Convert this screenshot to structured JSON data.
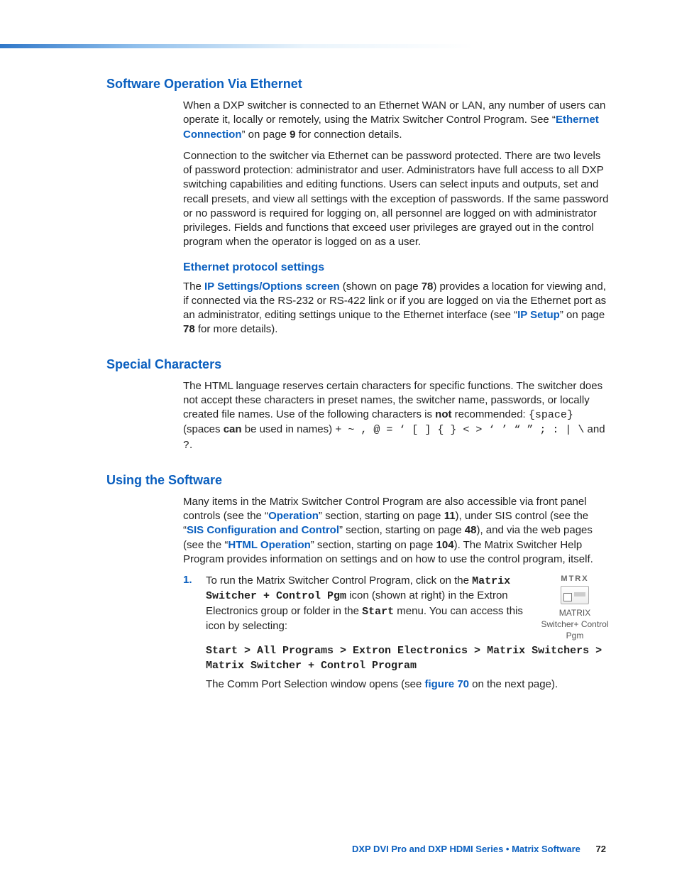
{
  "sections": {
    "swoe": {
      "title": "Software Operation Via Ethernet",
      "p1_a": "When a DXP switcher is connected to an Ethernet WAN or LAN, any number of users can operate it, locally or remotely, using the Matrix Switcher Control Program. See “",
      "p1_link": "Ethernet Connection",
      "p1_b": "” on page ",
      "p1_page": "9",
      "p1_c": " for connection details.",
      "p2": "Connection to the switcher via Ethernet can be password protected. There are two levels of password protection: administrator and user. Administrators have full access to all DXP switching capabilities and editing functions. Users can select inputs and outputs, set and recall presets, and view all settings with the exception of passwords. If the same password or no password is required for logging on, all personnel are logged on with administrator privileges. Fields and functions that exceed user privileges are grayed out in the control program when the operator is logged on as a user.",
      "sub_title": "Ethernet protocol settings",
      "p3_a": "The ",
      "p3_link1": "IP Settings/Options screen",
      "p3_b": " (shown on page ",
      "p3_page1": "78",
      "p3_c": ") provides a location for viewing and, if connected via the RS-232 or RS-422 link or if you are logged on via the Ethernet port as an administrator, editing settings unique to the Ethernet interface (see “",
      "p3_link2": "IP Setup",
      "p3_d": "” on page ",
      "p3_page2": "78",
      "p3_e": " for more details)."
    },
    "spec": {
      "title": "Special Characters",
      "p1_a": "The HTML language reserves certain characters for specific functions. The switcher does not accept these characters in preset names, the switcher name, passwords, or locally created file names. Use of the following characters is ",
      "p1_not": "not",
      "p1_b": " recommended: ",
      "p1_chars1": "{space}",
      "p1_c": " (spaces ",
      "p1_can": "can",
      "p1_d": " be used in names) ",
      "p1_chars2": "+ ~ , @ = ‘ [ ] { } < > ‘ ’ “ ” ; : | \\",
      "p1_e": " and ",
      "p1_chars3": "?",
      "p1_f": "."
    },
    "using": {
      "title": "Using the Software",
      "p1_a": "Many items in the Matrix Switcher Control Program are also accessible via front panel controls (see the “",
      "p1_link1": "Operation",
      "p1_b": "” section, starting on page ",
      "p1_page1": "11",
      "p1_c": "), under SIS control (see the “",
      "p1_link2": "SIS Configuration and Control",
      "p1_d": "” section, starting on page ",
      "p1_page2": "48",
      "p1_e": "), and via the web pages (see the “",
      "p1_link3": "HTML Operation",
      "p1_f": "” section, starting on page ",
      "p1_page3": "104",
      "p1_g": "). The Matrix Switcher Help Program provides information on settings and on how to use the control program, itself.",
      "step1_num": "1.",
      "step1_a": "To run the Matrix Switcher Control Program, click on the ",
      "step1_m1": "Matrix Switcher + Control Pgm",
      "step1_b": " icon (shown at right) in the Extron Electronics group or folder in the ",
      "step1_m2": "Start",
      "step1_c": " menu. You can access this icon by selecting:",
      "step1_path": "Start > All Programs > Extron Electronics > Matrix Switchers > Matrix Switcher + Control Program",
      "step1_d": "The Comm Port Selection window opens (see ",
      "step1_link": "figure 70",
      "step1_e": " on the next page).",
      "icon_top": "MTRX",
      "icon_caption": "MATRIX Switcher+ Control Pgm"
    }
  },
  "footer": {
    "title": "DXP DVI Pro and DXP HDMI Series • Matrix Software",
    "page": "72"
  }
}
